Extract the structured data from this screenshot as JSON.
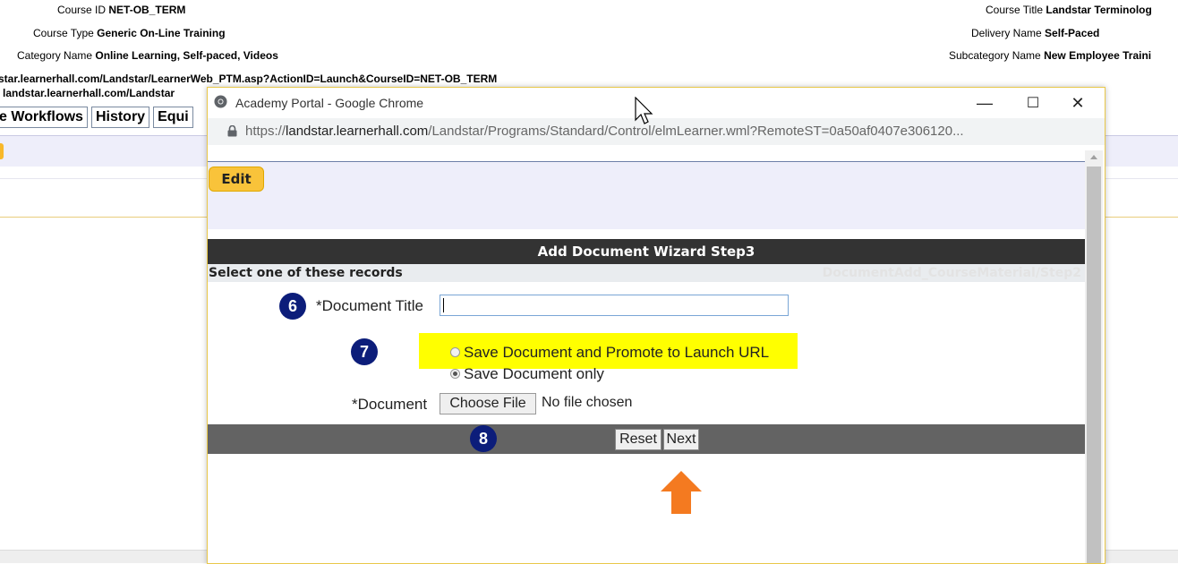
{
  "background_page": {
    "course_id_label": "Course ID",
    "course_id_value": "NET-OB_TERM",
    "course_type_label": "Course Type",
    "course_type_value": "Generic On-Line Training",
    "category_label": "Category Name",
    "category_value": "Online Learning, Self-paced, Videos",
    "course_title_label": "Course Title",
    "course_title_value": "Landstar Terminolog",
    "delivery_label": "Delivery Name",
    "delivery_value": "Self-Paced",
    "subcategory_label": "Subcategory Name",
    "subcategory_value": "New Employee Traini",
    "launch_url_1": "star.learnerhall.com/Landstar/LearnerWeb_PTM.asp?ActionID=Launch&CourseID=NET-OB_TERM",
    "launch_url_2": "landstar.learnerhall.com/Landstar",
    "tabs": [
      "e Workflows",
      "History",
      "Equi"
    ]
  },
  "popup": {
    "window_title": "Academy Portal - Google Chrome",
    "minimize_glyph": "—",
    "maximize_glyph": "☐",
    "close_glyph": "✕",
    "url_scheme": "https://",
    "url_host": "landstar.learnerhall.com",
    "url_path": "/Landstar/Programs/Standard/Control/elmLearner.wml?RemoteST=0a50af0407e306120...",
    "edit_label": "Edit",
    "wizard_title": "Add Document Wizard Step3",
    "select_label": "Select one of these records",
    "step_ref": "DocumentAdd_CourseMaterial/Step2",
    "document_title_label": "*Document Title",
    "document_title_value": "",
    "radio_option_1": "Save Document and Promote to Launch URL",
    "radio_option_2": "Save Document only",
    "selected_option": "Save Document only",
    "document_label": "*Document",
    "choose_file_label": "Choose File",
    "no_file_text": "No file chosen",
    "reset_label": "Reset",
    "next_label": "Next"
  },
  "annotations": {
    "badge_6": "6",
    "badge_7": "7",
    "badge_8": "8",
    "badge_color": "#0c1d7a",
    "highlight_color": "#ffff00",
    "arrow_color": "#f47a20"
  },
  "icons": [
    "chrome-icon",
    "lock-icon",
    "scroll-up-icon",
    "arrow-up-icon",
    "mouse-cursor-icon"
  ]
}
